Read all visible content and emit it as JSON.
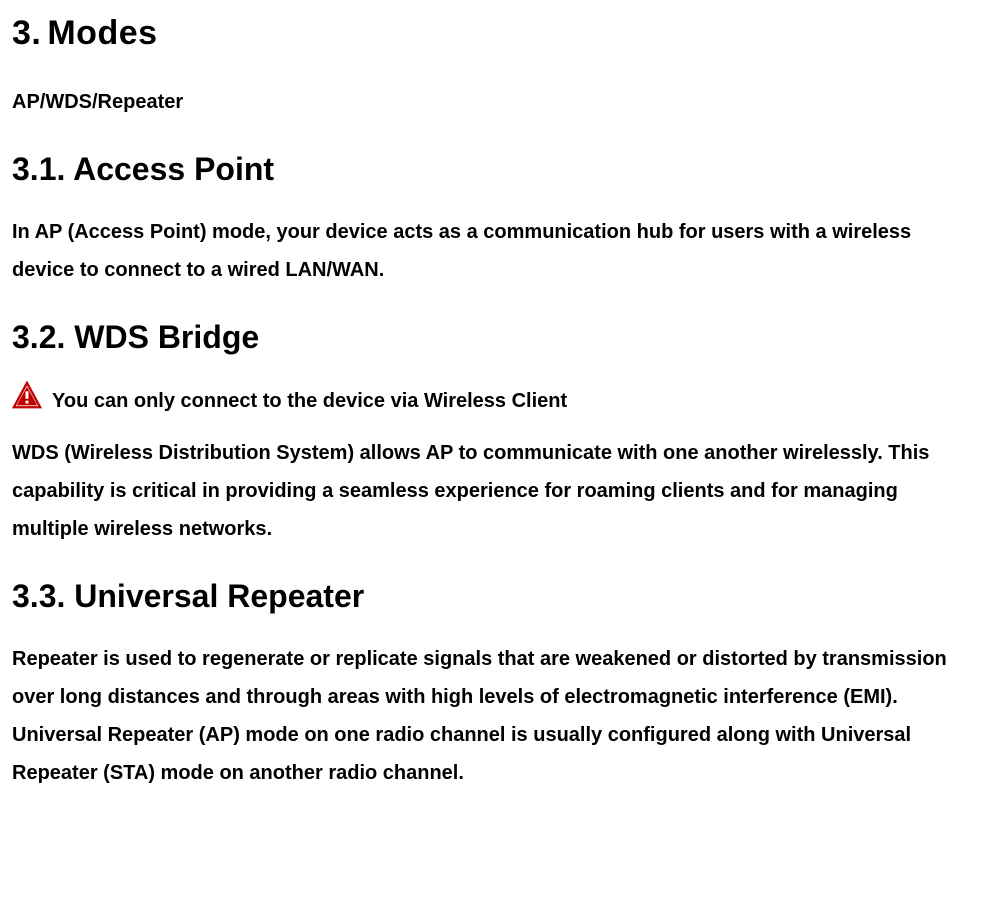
{
  "h1_number": "3.",
  "h1_title": "Modes",
  "sub_line": "AP/WDS/Repeater",
  "s1_heading": "3.1. Access Point",
  "s1_body": "In AP (Access Point) mode, your device acts as a communication hub for users with a wireless device to connect to a wired LAN/WAN.",
  "s2_heading": "3.2. WDS Bridge",
  "s2_warning": "You can only connect to the device via Wireless Client",
  "s2_body": "WDS (Wireless Distribution System) allows AP to communicate with one another wirelessly. This capability is critical in providing a seamless experience for roaming clients and for managing multiple wireless networks.",
  "s3_heading": "3.3. Universal Repeater",
  "s3_body": "Repeater is used to regenerate or replicate signals that are weakened or distorted by transmission over long distances and through areas with high levels of electromagnetic interference (EMI). Universal Repeater (AP) mode on one radio channel is usually configured along with Universal Repeater (STA) mode on another radio channel."
}
